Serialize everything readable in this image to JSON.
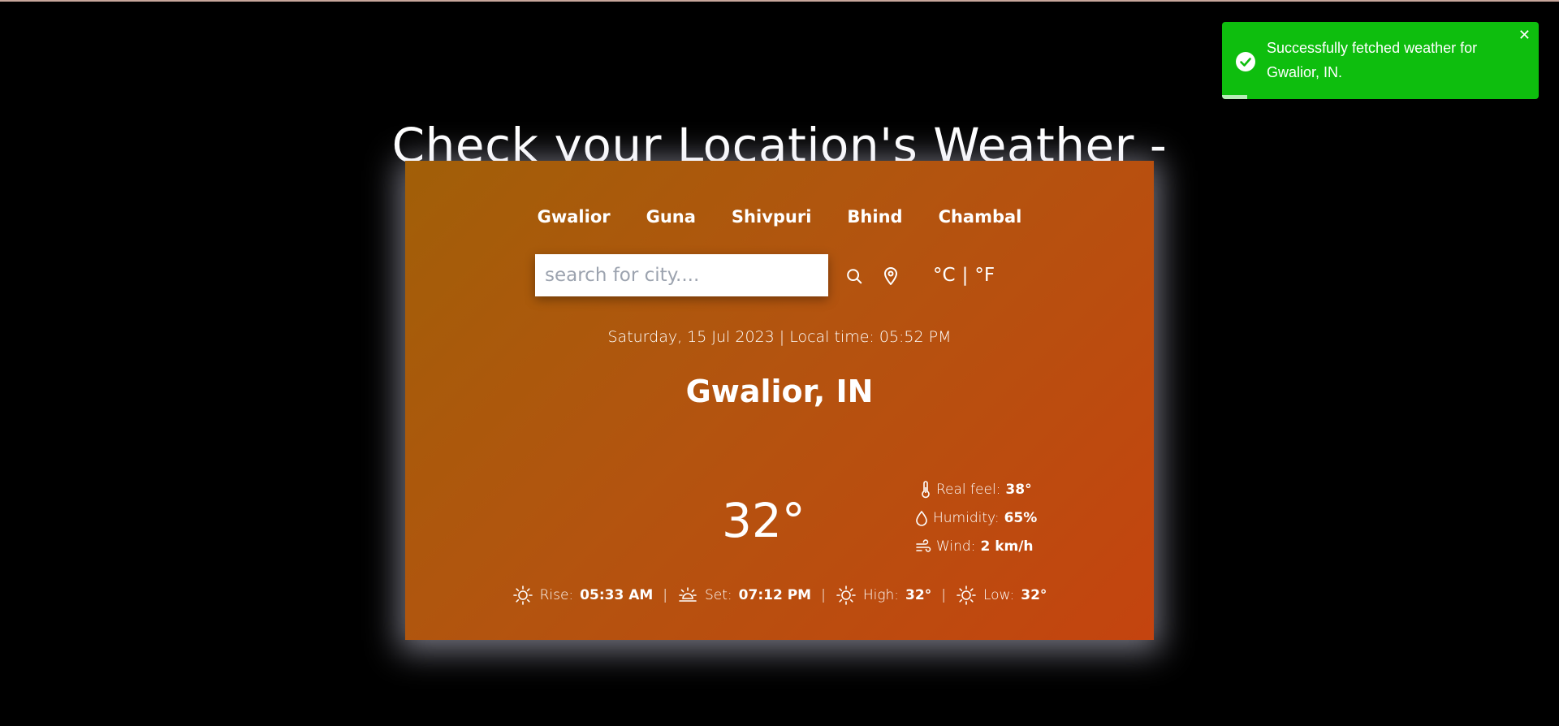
{
  "page": {
    "title": "Check your Location's Weather -"
  },
  "cities": [
    "Gwalior",
    "Guna",
    "Shivpuri",
    "Bhind",
    "Chambal"
  ],
  "search": {
    "placeholder": "search for city....",
    "value": ""
  },
  "icons": {
    "search": "search-icon",
    "location": "location-pin-icon",
    "thermometer": "thermometer-icon",
    "humidity": "droplet-icon",
    "wind": "wind-icon",
    "sunrise": "sun-icon",
    "sunset": "sunset-icon",
    "high": "sun-icon",
    "low": "sun-icon",
    "toast": "check-circle-icon",
    "close": "close-icon"
  },
  "units": {
    "celsius": "°C",
    "separator": "|",
    "fahrenheit": "°F"
  },
  "weather": {
    "datetime": "Saturday, 15 Jul 2023 | Local time: 05:52 PM",
    "location": "Gwalior, IN",
    "temperature": "32°",
    "details": {
      "real_feel_label": "Real feel:",
      "real_feel_value": "38°",
      "humidity_label": "Humidity:",
      "humidity_value": "65%",
      "wind_label": "Wind:",
      "wind_value": "2 km/h"
    },
    "astro": {
      "rise_label": "Rise:",
      "rise_value": "05:33 AM",
      "set_label": "Set:",
      "set_value": "07:12 PM",
      "high_label": "High:",
      "high_value": "32°",
      "low_label": "Low:",
      "low_value": "32°",
      "separator": "|"
    }
  },
  "toast": {
    "message": "Successfully fetched weather for Gwalior, IN.",
    "close_glyph": "✕",
    "progress": 0.08
  },
  "colors": {
    "card_gradient_start": "#a15f08",
    "card_gradient_end": "#c4440f",
    "toast_bg": "#0ebe0e",
    "page_bg": "#000000"
  }
}
